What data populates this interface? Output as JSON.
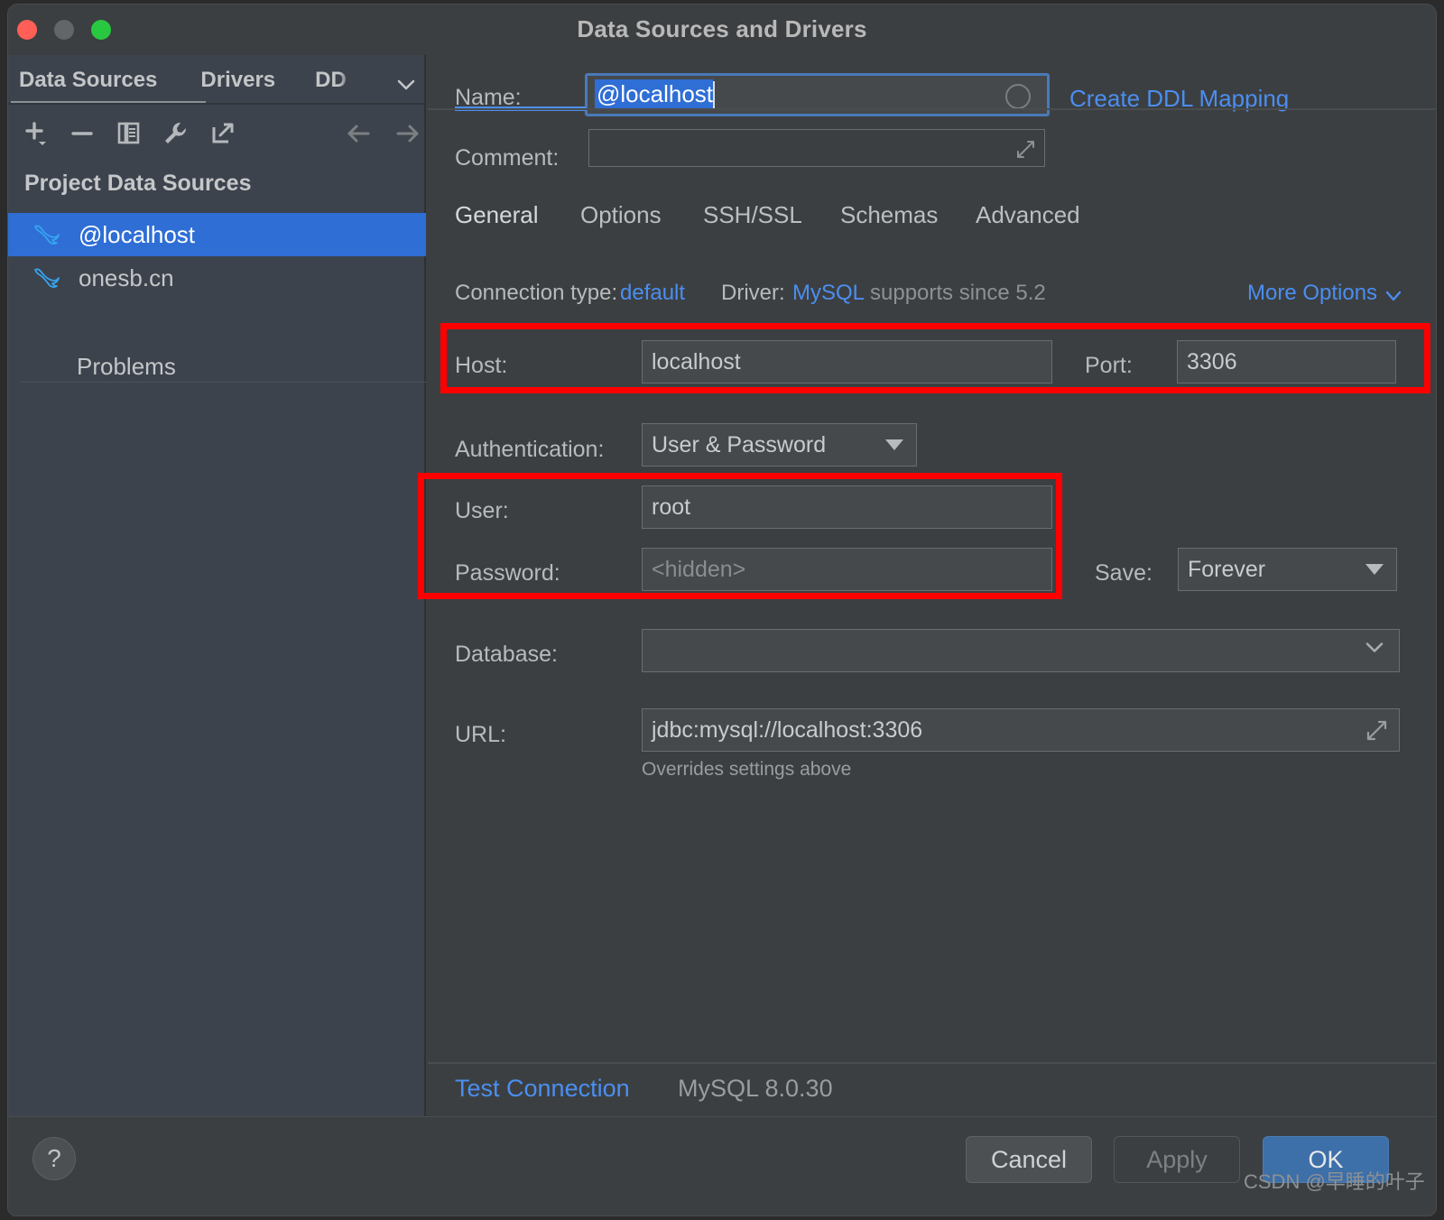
{
  "window": {
    "title": "Data Sources and Drivers",
    "traffic_lights": [
      "close-red",
      "minimize-yellow",
      "zoom-green"
    ]
  },
  "sidebar": {
    "tabs": [
      {
        "label": "Data Sources",
        "active": true
      },
      {
        "label": "Drivers",
        "active": false
      },
      {
        "label": "DD",
        "active": false,
        "truncated": true
      }
    ],
    "toolbar": [
      {
        "name": "add-button",
        "icon": "plus-icon"
      },
      {
        "name": "remove-button",
        "icon": "minus-icon"
      },
      {
        "name": "duplicate-button",
        "icon": "copy-icon"
      },
      {
        "name": "properties-button",
        "icon": "wrench-icon"
      },
      {
        "name": "export-button",
        "icon": "external-link-icon"
      },
      {
        "name": "back-button",
        "icon": "arrow-left-icon"
      },
      {
        "name": "forward-button",
        "icon": "arrow-right-icon"
      }
    ],
    "group_title": "Project Data Sources",
    "items": [
      {
        "label": "@localhost",
        "icon": "mysql-dolphin-icon",
        "selected": true
      },
      {
        "label": "onesb.cn",
        "icon": "mysql-dolphin-icon",
        "selected": false
      }
    ],
    "problems_label": "Problems"
  },
  "form": {
    "name_label": "Name:",
    "name_value": "@localhost",
    "comment_label": "Comment:",
    "comment_value": "",
    "create_ddl_mapping": "Create DDL Mapping"
  },
  "tabs": [
    {
      "label": "General",
      "active": true
    },
    {
      "label": "Options",
      "active": false
    },
    {
      "label": "SSH/SSL",
      "active": false
    },
    {
      "label": "Schemas",
      "active": false
    },
    {
      "label": "Advanced",
      "active": false
    }
  ],
  "connection": {
    "type_label": "Connection type:",
    "type_value": "default",
    "driver_label": "Driver:",
    "driver_value": "MySQL",
    "driver_note": "supports since 5.2",
    "more_options": "More Options"
  },
  "general": {
    "host_label": "Host:",
    "host_value": "localhost",
    "port_label": "Port:",
    "port_value": "3306",
    "auth_label": "Authentication:",
    "auth_value": "User & Password",
    "user_label": "User:",
    "user_value": "root",
    "password_label": "Password:",
    "password_placeholder": "<hidden>",
    "save_label": "Save:",
    "save_value": "Forever",
    "database_label": "Database:",
    "database_value": "",
    "url_label": "URL:",
    "url_value": "jdbc:mysql://localhost:3306",
    "url_hint": "Overrides settings above"
  },
  "footer": {
    "test_connection": "Test Connection",
    "driver_version": "MySQL 8.0.30",
    "help": "?",
    "cancel": "Cancel",
    "apply": "Apply",
    "ok": "OK"
  },
  "watermark": "CSDN @早睡的叶子",
  "colors": {
    "accent_blue": "#4b8ef0",
    "selection_blue": "#2f6ed5",
    "annotation_red": "#ff0000",
    "primary_button": "#3d6fa8"
  }
}
